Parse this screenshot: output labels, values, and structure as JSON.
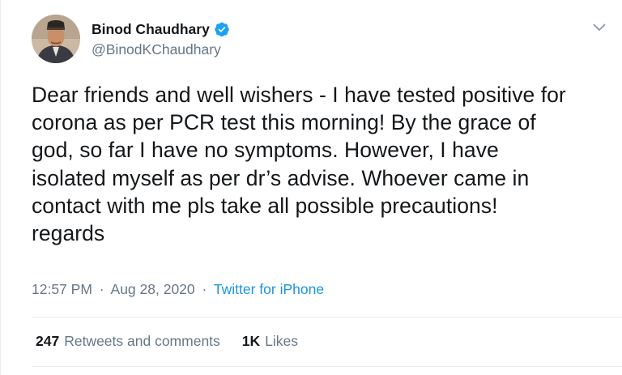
{
  "author": {
    "display_name": "Binod Chaudhary",
    "handle": "@BinodKChaudhary",
    "avatar_icon": "avatar-photo",
    "verified_icon": "verified-badge-icon"
  },
  "tweet": {
    "text": "Dear friends and well wishers - I have tested positive for\ncorona as per PCR test this morning! By the grace of\ngod, so far I have no symptoms. However, I have\nisolated myself as per dr’s advise. Whoever came in\ncontact with me pls take all possible precautions!\nregards",
    "time": "12:57 PM",
    "separator": "·",
    "date": "Aug 28, 2020",
    "source": "Twitter for iPhone"
  },
  "stats": {
    "retweets_count": "247",
    "retweets_label": "Retweets and comments",
    "likes_count": "1K",
    "likes_label": "Likes"
  },
  "colors": {
    "accent": "#1b95e0",
    "secondary_text": "#657786",
    "primary_text": "#14171a",
    "divider": "#e6ecf0"
  },
  "menu_icon": "chevron-down-icon"
}
